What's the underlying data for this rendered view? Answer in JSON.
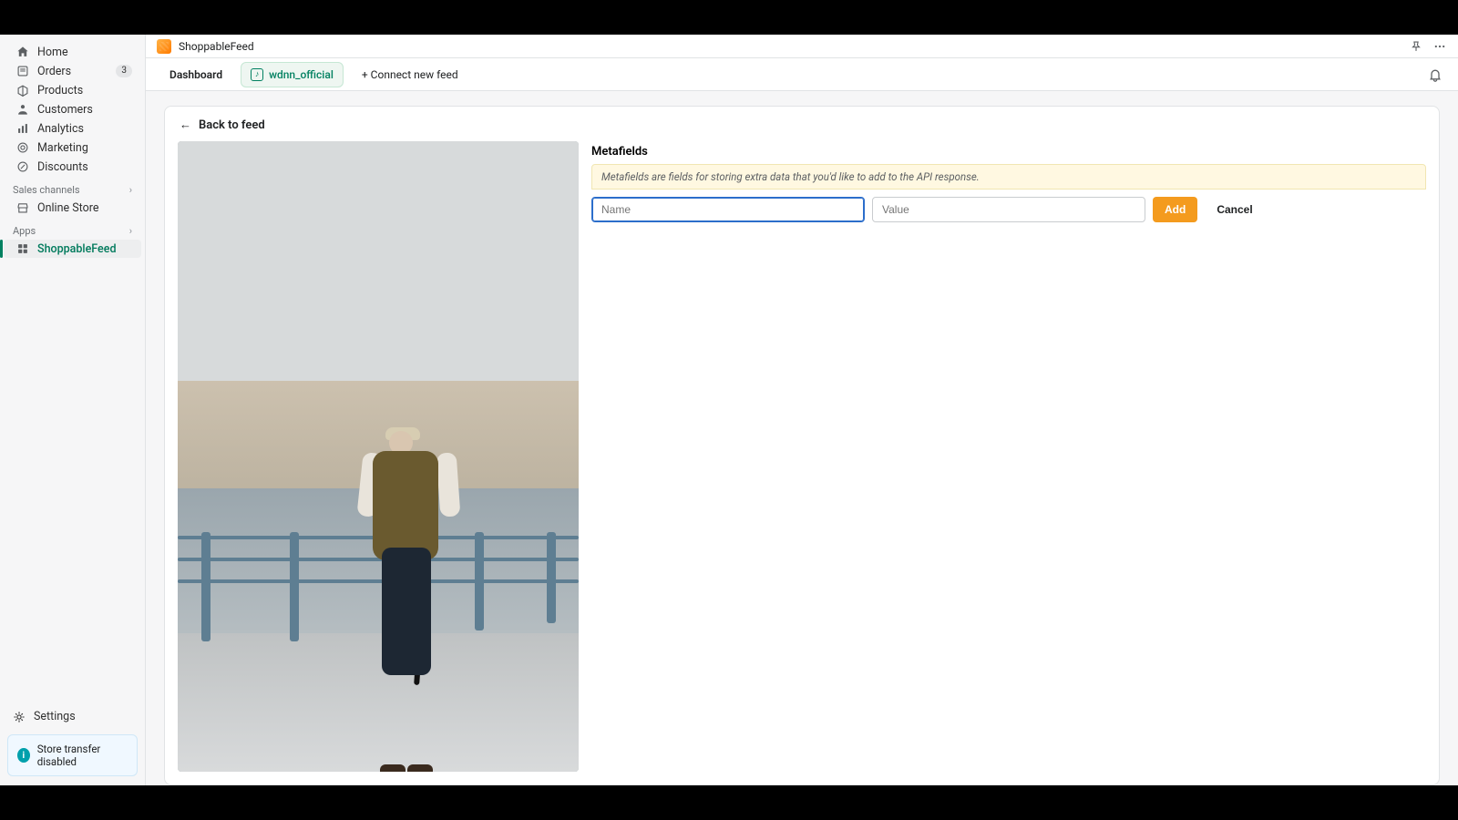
{
  "app": {
    "name": "ShoppableFeed"
  },
  "sidebar": {
    "items": [
      {
        "label": "Home"
      },
      {
        "label": "Orders",
        "badge": "3"
      },
      {
        "label": "Products"
      },
      {
        "label": "Customers"
      },
      {
        "label": "Analytics"
      },
      {
        "label": "Marketing"
      },
      {
        "label": "Discounts"
      }
    ],
    "sales_section": "Sales channels",
    "sales_items": [
      {
        "label": "Online Store"
      }
    ],
    "apps_section": "Apps",
    "apps_items": [
      {
        "label": "ShoppableFeed"
      }
    ],
    "settings": "Settings",
    "transfer_note": "Store transfer disabled"
  },
  "tabs": {
    "dashboard": "Dashboard",
    "feed_handle": "wdnn_official",
    "connect": "+ Connect new feed"
  },
  "page": {
    "back": "Back to feed",
    "meta_title": "Metafields",
    "meta_hint": "Metafields are fields for storing extra data that you'd like to add to the API response.",
    "name_placeholder": "Name",
    "value_placeholder": "Value",
    "add": "Add",
    "cancel": "Cancel"
  }
}
